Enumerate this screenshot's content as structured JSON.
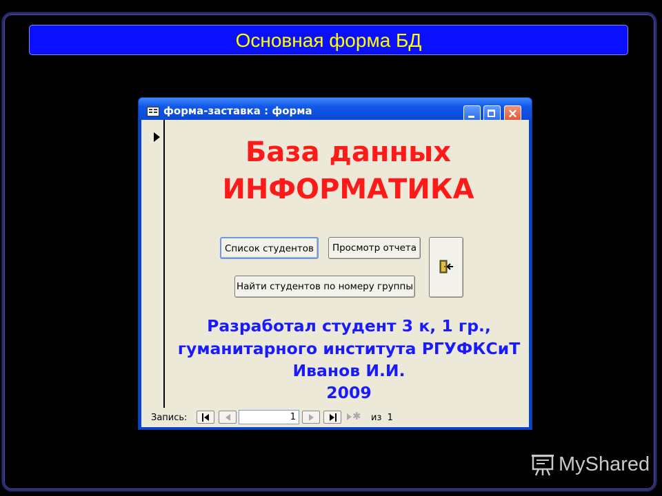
{
  "slide": {
    "title": "Основная форма БД"
  },
  "window": {
    "title": "форма-заставка : форма",
    "close_glyph": "✕"
  },
  "form": {
    "heading_line1": "База данных",
    "heading_line2": "ИНФОРМАТИКА",
    "buttons": {
      "students_list": "Список студентов",
      "view_report": "Просмотр отчета",
      "find_by_group": "Найти студентов по номеру группы"
    },
    "credits": [
      "Разработал студент 3 к, 1 гр.,",
      "гуманитарного института РГУФКСиТ",
      "Иванов И.И.",
      "2009"
    ]
  },
  "navigation": {
    "record_label": "Запись:",
    "current_record": "1",
    "of_label": "из",
    "total_records": "1"
  },
  "watermark": {
    "text": "MyShared"
  },
  "colors": {
    "slide_title_bg": "#0a10ff",
    "slide_title_text": "#ffff00",
    "heading_red": "#ff1a1a",
    "credits_blue": "#1a1aff",
    "form_bg": "#ece9d8"
  }
}
